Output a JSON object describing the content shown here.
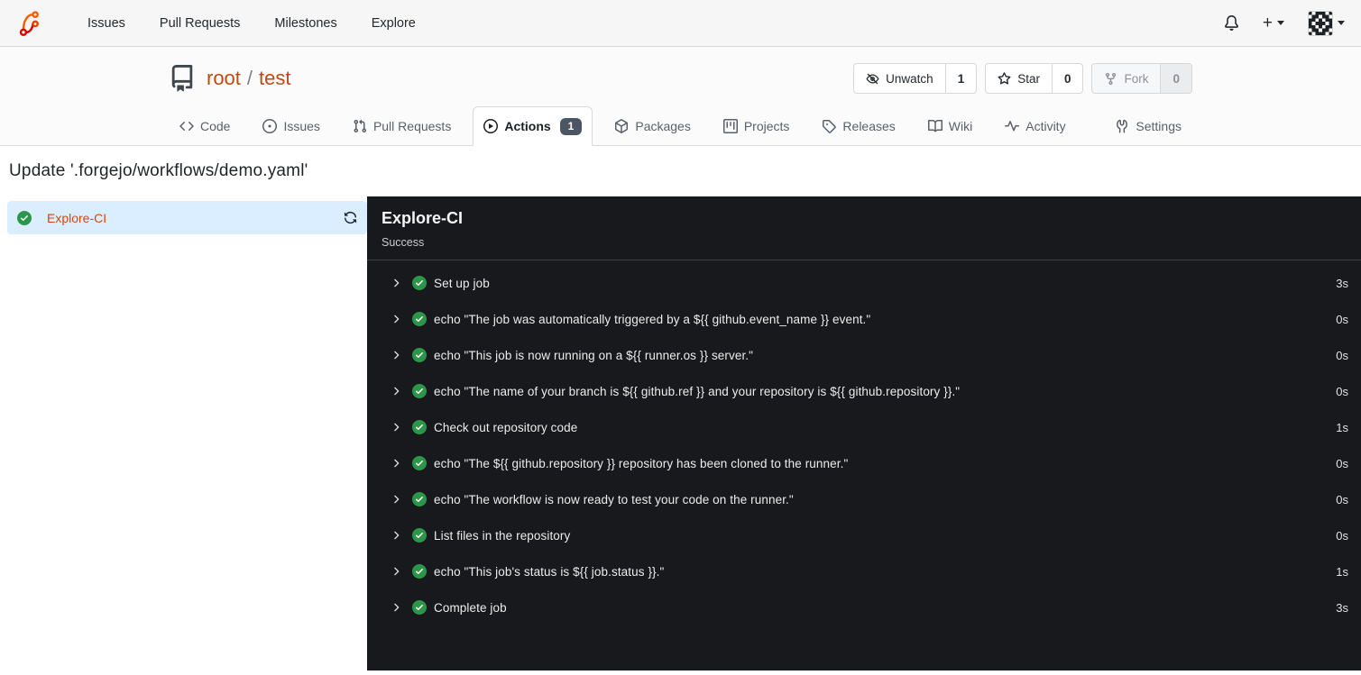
{
  "topnav": {
    "items": [
      "Issues",
      "Pull Requests",
      "Milestones",
      "Explore"
    ],
    "create_label": "+",
    "icons": [
      "forgejo-logo",
      "bell-icon",
      "plus-dropdown",
      "avatar-dropdown"
    ]
  },
  "repo": {
    "owner": "root",
    "separator": "/",
    "name": "test",
    "actions": {
      "unwatch": {
        "label": "Unwatch",
        "count": "1"
      },
      "star": {
        "label": "Star",
        "count": "0"
      },
      "fork": {
        "label": "Fork",
        "count": "0",
        "disabled": true
      }
    },
    "tabs": [
      {
        "label": "Code"
      },
      {
        "label": "Issues"
      },
      {
        "label": "Pull Requests"
      },
      {
        "label": "Actions",
        "badge": "1",
        "active": true
      },
      {
        "label": "Packages"
      },
      {
        "label": "Projects"
      },
      {
        "label": "Releases"
      },
      {
        "label": "Wiki"
      },
      {
        "label": "Activity"
      },
      {
        "label": "Settings"
      }
    ]
  },
  "run": {
    "title": "Update '.forgejo/workflows/demo.yaml'",
    "job": {
      "name": "Explore-CI",
      "status_icon": "success"
    },
    "panel": {
      "title": "Explore-CI",
      "status": "Success"
    },
    "steps": [
      {
        "name": "Set up job",
        "duration": "3s"
      },
      {
        "name": "echo \"The job was automatically triggered by a ${{ github.event_name }} event.\"",
        "duration": "0s"
      },
      {
        "name": "echo \"This job is now running on a ${{ runner.os }} server.\"",
        "duration": "0s"
      },
      {
        "name": "echo \"The name of your branch is ${{ github.ref }} and your repository is ${{ github.repository }}.\"",
        "duration": "0s"
      },
      {
        "name": "Check out repository code",
        "duration": "1s"
      },
      {
        "name": "echo \"The ${{ github.repository }} repository has been cloned to the runner.\"",
        "duration": "0s"
      },
      {
        "name": "echo \"The workflow is now ready to test your code on the runner.\"",
        "duration": "0s"
      },
      {
        "name": "List files in the repository",
        "duration": "0s"
      },
      {
        "name": "echo \"This job's status is ${{ job.status }}.\"",
        "duration": "1s"
      },
      {
        "name": "Complete job",
        "duration": "3s"
      }
    ]
  },
  "colors": {
    "primary_orange": "#c2490e",
    "success_green": "#2c974b",
    "selected_job_bg": "#dbeeff",
    "console_bg": "#17191c",
    "header_bg": "#f6f6f7",
    "badge_bg": "#4c5564"
  }
}
